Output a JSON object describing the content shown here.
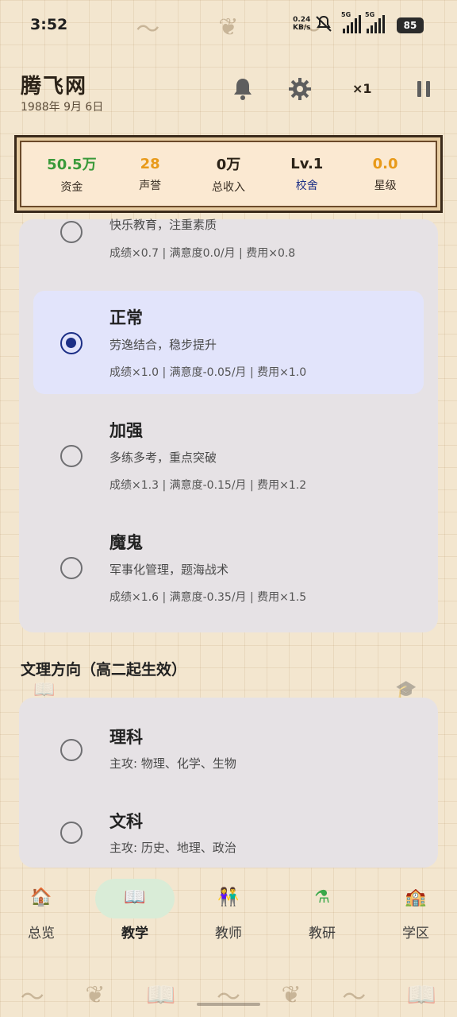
{
  "status_bar": {
    "time": "3:52",
    "net_speed_value": "0.24",
    "net_speed_unit": "KB/s",
    "sim1_label": "5G",
    "sim2_label": "5G",
    "battery": "85"
  },
  "header": {
    "school_name": "腾飞网",
    "date": "1988年 9月 6日",
    "speed": "×1"
  },
  "stats": [
    {
      "value": "50.5万",
      "label": "资金",
      "value_color": "#3a9a3a",
      "label_color": "#3a2f24"
    },
    {
      "value": "28",
      "label": "声誉",
      "value_color": "#e89a1a",
      "label_color": "#3a2f24"
    },
    {
      "value": "0万",
      "label": "总收入",
      "value_color": "#2b2217",
      "label_color": "#3a2f24"
    },
    {
      "value": "Lv.1",
      "label": "校舍",
      "value_color": "#2b2217",
      "label_color": "#1c2f86"
    },
    {
      "value": "0.0",
      "label": "星级",
      "value_color": "#e89a1a",
      "label_color": "#3a2f24"
    }
  ],
  "intensity_options": [
    {
      "title": "",
      "desc": "快乐教育，注重素质",
      "stats": "成绩×0.7 | 满意度0.0/月 | 费用×0.8",
      "selected": false
    },
    {
      "title": "正常",
      "desc": "劳逸结合，稳步提升",
      "stats": "成绩×1.0 | 满意度-0.05/月 | 费用×1.0",
      "selected": true
    },
    {
      "title": "加强",
      "desc": "多练多考，重点突破",
      "stats": "成绩×1.3 | 满意度-0.15/月 | 费用×1.2",
      "selected": false
    },
    {
      "title": "魔鬼",
      "desc": "军事化管理，题海战术",
      "stats": "成绩×1.6 | 满意度-0.35/月 | 费用×1.5",
      "selected": false
    }
  ],
  "track_section": {
    "title": "文理方向（高二起生效）",
    "options": [
      {
        "title": "理科",
        "desc": "主攻: 物理、化学、生物",
        "selected": false
      },
      {
        "title": "文科",
        "desc": "主攻: 历史、地理、政治",
        "selected": false
      }
    ]
  },
  "nav": [
    {
      "label": "总览",
      "icon": "school-house-icon",
      "glyph": "🏠",
      "active": false
    },
    {
      "label": "教学",
      "icon": "open-book-icon",
      "glyph": "📖",
      "active": true
    },
    {
      "label": "教师",
      "icon": "teachers-icon",
      "glyph": "👫",
      "active": false
    },
    {
      "label": "教研",
      "icon": "flask-icon",
      "glyph": "⚗",
      "active": false
    },
    {
      "label": "学区",
      "icon": "school-building-icon",
      "glyph": "🏫",
      "active": false
    }
  ],
  "colors": {
    "accent": "#1c2f86",
    "card_bg": "#e6e2e5",
    "selected_bg": "#e2e4fb",
    "nav_active_pill": "#d9ecd7"
  }
}
